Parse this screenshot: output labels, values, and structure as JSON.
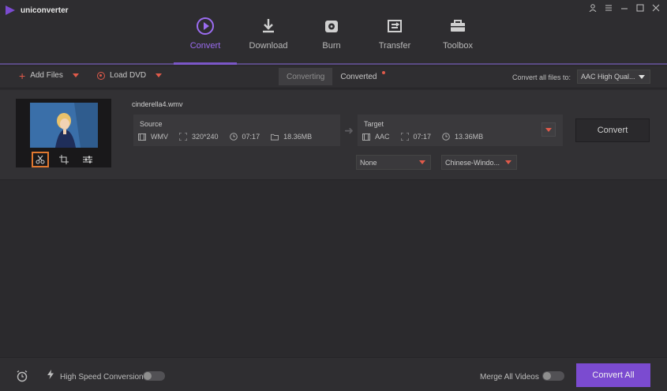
{
  "app": {
    "title": "uniconverter"
  },
  "nav": {
    "items": [
      {
        "label": "Convert",
        "icon": "convert-icon",
        "active": true
      },
      {
        "label": "Download",
        "icon": "download-icon"
      },
      {
        "label": "Burn",
        "icon": "burn-icon"
      },
      {
        "label": "Transfer",
        "icon": "transfer-icon"
      },
      {
        "label": "Toolbox",
        "icon": "toolbox-icon"
      }
    ]
  },
  "toolbar": {
    "add_files": "Add Files",
    "load_dvd": "Load DVD",
    "tabs": [
      {
        "label": "Converting",
        "selected": true
      },
      {
        "label": "Converted",
        "has_dot": true
      }
    ],
    "convert_all_label": "Convert all files to:",
    "convert_all_value": "AAC High Qual..."
  },
  "file": {
    "name": "cinderella4.wmv",
    "source": {
      "title": "Source",
      "format": "WMV",
      "resolution": "320*240",
      "duration": "07:17",
      "size": "18.36MB"
    },
    "target": {
      "title": "Target",
      "format": "AAC",
      "resolution": "07:17",
      "duration": "07:17",
      "size": "13.36MB"
    },
    "convert_label": "Convert",
    "subtitle_select": "None",
    "audio_select": "Chinese-Windo..."
  },
  "bottom": {
    "high_speed_label": "High Speed Conversion",
    "merge_label": "Merge All Videos",
    "convert_all_label": "Convert All"
  },
  "colors": {
    "accent": "#7b4bd0",
    "accent_text": "#9b6cf0",
    "warning": "#e05a4a"
  }
}
